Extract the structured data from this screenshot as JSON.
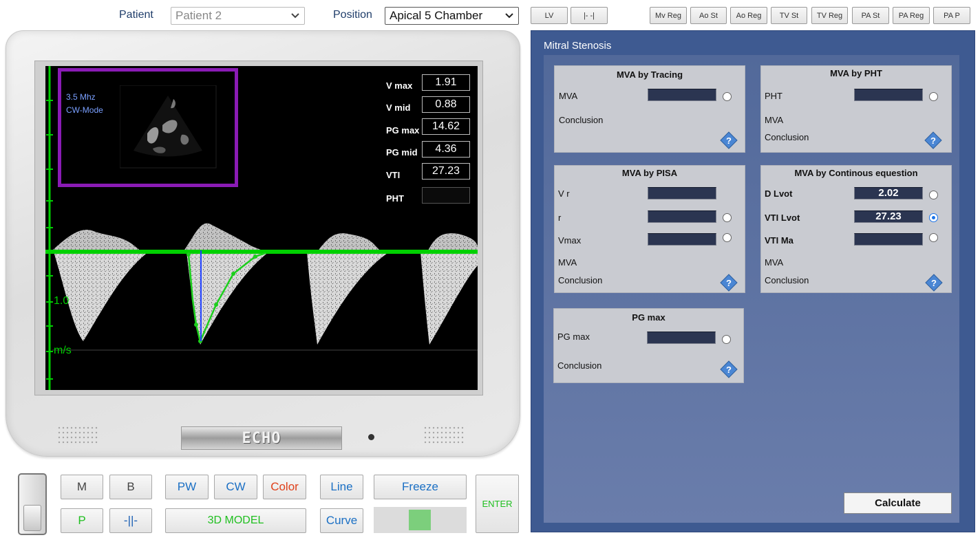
{
  "topbar": {
    "patient_label": "Patient",
    "patient_value": "Patient 2",
    "position_label": "Position",
    "position_value": "Apical 5 Chamber",
    "view_buttons": [
      "LV",
      "|- -|"
    ],
    "valve_buttons": [
      "Mv Reg",
      "Ao St",
      "Ao Reg",
      "TV St",
      "TV Reg",
      "PA St",
      "PA Reg",
      "PA P"
    ]
  },
  "screen": {
    "freq": "3.5 Mhz",
    "mode": "CW-Mode",
    "scale_value": "1.0",
    "scale_unit": "m/s",
    "measurements": [
      {
        "label": "V max",
        "value": "1.91"
      },
      {
        "label": "V mid",
        "value": "0.88"
      },
      {
        "label": "PG max",
        "value": "14.62"
      },
      {
        "label": "PG mid",
        "value": "4.36"
      },
      {
        "label": "VTI",
        "value": "27.23"
      },
      {
        "label": "PHT",
        "value": ""
      }
    ]
  },
  "monitor": {
    "brand": "ECHO"
  },
  "controls": {
    "m": "M",
    "b": "B",
    "p": "P",
    "split": "-||-",
    "pw": "PW",
    "cw": "CW",
    "color": "Color",
    "model3d": "3D MODEL",
    "line": "Line",
    "curve": "Curve",
    "freeze": "Freeze",
    "enter": "ENTER"
  },
  "panel": {
    "title": "Mitral Stenosis",
    "tracing": {
      "title": "MVA by Tracing",
      "mva": "MVA",
      "mva_value": "",
      "conclusion": "Conclusion"
    },
    "pht": {
      "title": "MVA by PHT",
      "pht": "PHT",
      "pht_value": "",
      "mva": "MVA",
      "conclusion": "Conclusion"
    },
    "pisa": {
      "title": "MVA by PISA",
      "vr": "V r",
      "r": "r",
      "vmax": "Vmax",
      "mva": "MVA",
      "conclusion": "Conclusion"
    },
    "continuous": {
      "title": "MVA by Continous equestion",
      "dlvot": "D Lvot",
      "dlvot_value": "2.02",
      "vtilvot": "VTI Lvot",
      "vtilvot_value": "27.23",
      "vtima": "VTI Ma",
      "vtima_value": "",
      "mva": "MVA",
      "conclusion": "Conclusion"
    },
    "pgmax": {
      "title": "PG max",
      "pgmax": "PG max",
      "pgmax_value": "",
      "conclusion": "Conclusion"
    },
    "calculate": "Calculate"
  },
  "colors": {
    "accent_green": "#00d000",
    "panel_blue": "#3e5a91",
    "roi_purple": "#8a1bb5"
  }
}
